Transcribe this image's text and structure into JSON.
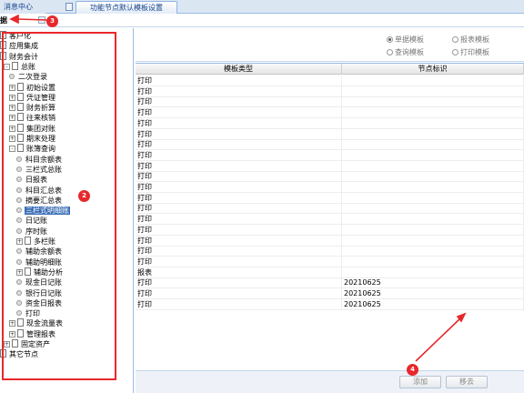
{
  "tabs": [
    {
      "label": "消息中心"
    },
    {
      "label": "功能节点默认模板设置"
    }
  ],
  "subbar": {
    "title": "据"
  },
  "tree": [
    {
      "label": "客户化",
      "kind": "doc",
      "level": 0,
      "toggle": ""
    },
    {
      "label": "应用集成",
      "kind": "doc",
      "level": 0,
      "toggle": ""
    },
    {
      "label": "财务会计",
      "kind": "doc",
      "level": 0,
      "toggle": ""
    },
    {
      "label": "总账",
      "kind": "doc",
      "level": 1,
      "toggle": "-"
    },
    {
      "label": "二次登录",
      "kind": "leaf",
      "level": 2,
      "toggle": ""
    },
    {
      "label": "初始设置",
      "kind": "doc",
      "level": 2,
      "toggle": "+"
    },
    {
      "label": "凭证管理",
      "kind": "doc",
      "level": 2,
      "toggle": "+"
    },
    {
      "label": "财务折算",
      "kind": "doc",
      "level": 2,
      "toggle": "+"
    },
    {
      "label": "往来核销",
      "kind": "doc",
      "level": 2,
      "toggle": "+"
    },
    {
      "label": "集团对账",
      "kind": "doc",
      "level": 2,
      "toggle": "+"
    },
    {
      "label": "期末处理",
      "kind": "doc",
      "level": 2,
      "toggle": "+"
    },
    {
      "label": "账簿查询",
      "kind": "doc",
      "level": 2,
      "toggle": "-"
    },
    {
      "label": "科目余额表",
      "kind": "leaf",
      "level": 3,
      "toggle": ""
    },
    {
      "label": "三栏式总账",
      "kind": "leaf",
      "level": 3,
      "toggle": ""
    },
    {
      "label": "日报表",
      "kind": "leaf",
      "level": 3,
      "toggle": ""
    },
    {
      "label": "科目汇总表",
      "kind": "leaf",
      "level": 3,
      "toggle": ""
    },
    {
      "label": "摘要汇总表",
      "kind": "leaf",
      "level": 3,
      "toggle": ""
    },
    {
      "label": "三栏式明细账",
      "kind": "leaf",
      "level": 3,
      "toggle": "",
      "selected": true
    },
    {
      "label": "日记账",
      "kind": "leaf",
      "level": 3,
      "toggle": ""
    },
    {
      "label": "序时账",
      "kind": "leaf",
      "level": 3,
      "toggle": ""
    },
    {
      "label": "多栏账",
      "kind": "doc",
      "level": 3,
      "toggle": "+"
    },
    {
      "label": "辅助余额表",
      "kind": "leaf",
      "level": 3,
      "toggle": ""
    },
    {
      "label": "辅助明细账",
      "kind": "leaf",
      "level": 3,
      "toggle": ""
    },
    {
      "label": "辅助分析",
      "kind": "doc",
      "level": 3,
      "toggle": "+"
    },
    {
      "label": "现金日记账",
      "kind": "leaf",
      "level": 3,
      "toggle": ""
    },
    {
      "label": "银行日记账",
      "kind": "leaf",
      "level": 3,
      "toggle": ""
    },
    {
      "label": "资金日报表",
      "kind": "leaf",
      "level": 3,
      "toggle": ""
    },
    {
      "label": "打印",
      "kind": "leaf",
      "level": 3,
      "toggle": ""
    },
    {
      "label": "现金流量表",
      "kind": "doc",
      "level": 2,
      "toggle": "+"
    },
    {
      "label": "管理报表",
      "kind": "doc",
      "level": 2,
      "toggle": "+"
    },
    {
      "label": "固定资产",
      "kind": "doc",
      "level": 1,
      "toggle": "+"
    },
    {
      "label": "其它节点",
      "kind": "doc",
      "level": 0,
      "toggle": ""
    }
  ],
  "options": [
    {
      "label": "单据模板",
      "checked": true
    },
    {
      "label": "报表模板",
      "checked": false
    },
    {
      "label": "查询模板",
      "checked": false
    },
    {
      "label": "打印模板",
      "checked": false
    }
  ],
  "grid": {
    "columns": [
      "模板类型",
      "节点标识"
    ],
    "rows": [
      [
        "打印",
        ""
      ],
      [
        "打印",
        ""
      ],
      [
        "打印",
        ""
      ],
      [
        "打印",
        ""
      ],
      [
        "打印",
        ""
      ],
      [
        "打印",
        ""
      ],
      [
        "打印",
        ""
      ],
      [
        "打印",
        ""
      ],
      [
        "打印",
        ""
      ],
      [
        "打印",
        ""
      ],
      [
        "打印",
        ""
      ],
      [
        "打印",
        ""
      ],
      [
        "打印",
        ""
      ],
      [
        "打印",
        ""
      ],
      [
        "打印",
        ""
      ],
      [
        "打印",
        ""
      ],
      [
        "打印",
        ""
      ],
      [
        "打印",
        ""
      ],
      [
        "报表",
        ""
      ],
      [
        "打印",
        "20210625"
      ],
      [
        "打印",
        "20210625"
      ],
      [
        "打印",
        "20210625"
      ]
    ]
  },
  "buttons": {
    "add": "添加",
    "move": "移去"
  },
  "annotations": [
    "2",
    "3",
    "4"
  ],
  "colors": {
    "annotation": "#e8282b",
    "selection": "#3a6db5",
    "border": "#99bbe8"
  }
}
